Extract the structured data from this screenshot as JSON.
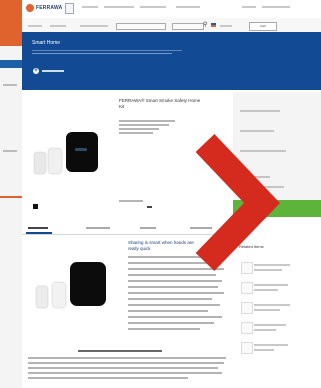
{
  "header": {
    "logo_text": "FERRAWA",
    "cart_label": "Cart"
  },
  "banner": {
    "title": "Smart Home"
  },
  "product": {
    "title_line1": "FERRAWA® Smart Smoke Safety Home",
    "title_line2": "Kit"
  },
  "description": {
    "title_line1": "Sharing is smart when hands are",
    "title_line2": "really quick"
  },
  "sidebar": {
    "title": "Related Items"
  },
  "colors": {
    "brand_blue": "#124a94",
    "brand_orange": "#e0622c",
    "buy_green": "#5cb53a",
    "chevron_red": "#d52b1e"
  },
  "icons": [
    "logo-icon",
    "search-icon",
    "flag-icon",
    "add-icon",
    "chevron-right-icon"
  ]
}
